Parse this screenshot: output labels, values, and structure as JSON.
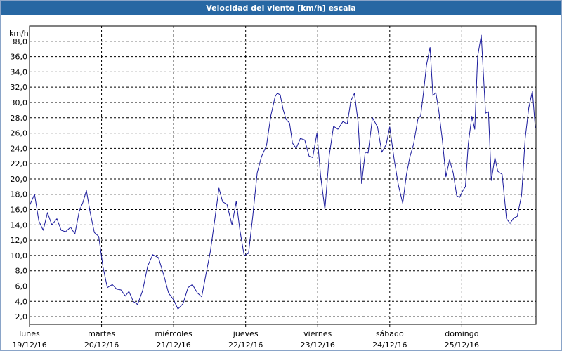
{
  "window": {
    "title": "Velocidad del viento [km/h] escala"
  },
  "colors": {
    "title_bar": "#2767a3",
    "series": "#1a1a9c",
    "grid": "#000000"
  },
  "chart_data": {
    "type": "line",
    "title": "Velocidad del viento [km/h] escala",
    "ylabel": "km/h",
    "xlabel": "",
    "ylim": [
      1.0,
      40.0
    ],
    "xlim": [
      0,
      7.03
    ],
    "grid": true,
    "y_ticks": [
      "2,0",
      "4,0",
      "6,0",
      "8,0",
      "10,0",
      "12,0",
      "14,0",
      "16,0",
      "18,0",
      "20,0",
      "22,0",
      "24,0",
      "26,0",
      "28,0",
      "30,0",
      "32,0",
      "34,0",
      "36,0",
      "38,0"
    ],
    "x_ticks": [
      {
        "day": "lunes",
        "date": "19/12/16"
      },
      {
        "day": "martes",
        "date": "20/12/16"
      },
      {
        "day": "miércoles",
        "date": "21/12/16"
      },
      {
        "day": "jueves",
        "date": "22/12/16"
      },
      {
        "day": "viernes",
        "date": "23/12/16"
      },
      {
        "day": "sábado",
        "date": "24/12/16"
      },
      {
        "day": "domingo",
        "date": "25/12/16"
      }
    ],
    "series": [
      {
        "name": "",
        "x": [
          0,
          0.07,
          0.13,
          0.19,
          0.25,
          0.31,
          0.38,
          0.44,
          0.5,
          0.57,
          0.63,
          0.69,
          0.74,
          0.79,
          0.84,
          0.9,
          0.96,
          1.02,
          1.08,
          1.15,
          1.21,
          1.27,
          1.33,
          1.38,
          1.44,
          1.5,
          1.57,
          1.64,
          1.71,
          1.79,
          1.87,
          1.93,
          2,
          2.06,
          2.13,
          2.2,
          2.26,
          2.33,
          2.39,
          2.45,
          2.51,
          2.57,
          2.63,
          2.68,
          2.74,
          2.81,
          2.87,
          2.92,
          2.98,
          3.04,
          3.1,
          3.16,
          3.22,
          3.29,
          3.35,
          3.41,
          3.44,
          3.48,
          3.52,
          3.56,
          3.61,
          3.65,
          3.7,
          3.76,
          3.82,
          3.88,
          3.93,
          3.99,
          4.04,
          4.1,
          4.16,
          4.22,
          4.28,
          4.35,
          4.41,
          4.46,
          4.51,
          4.56,
          4.61,
          4.66,
          4.7,
          4.76,
          4.83,
          4.89,
          4.95,
          5,
          5.06,
          5.12,
          5.18,
          5.23,
          5.28,
          5.33,
          5.39,
          5.43,
          5.47,
          5.51,
          5.56,
          5.6,
          5.64,
          5.68,
          5.73,
          5.78,
          5.83,
          5.88,
          5.93,
          5.97,
          6.01,
          6.05,
          6.09,
          6.14,
          6.18,
          6.22,
          6.27,
          6.33,
          6.37,
          6.41,
          6.46,
          6.5,
          6.56,
          6.62,
          6.67,
          6.72,
          6.77,
          6.83,
          6.88,
          6.93,
          6.98,
          7.02
        ],
        "y": [
          16.5,
          18,
          14.5,
          13.3,
          15.6,
          14,
          14.8,
          13.3,
          13.1,
          13.7,
          12.8,
          15.8,
          16.9,
          18.5,
          15.7,
          13,
          12.5,
          8.5,
          5.8,
          6.2,
          5.6,
          5.5,
          4.7,
          5.3,
          4,
          3.6,
          5.4,
          8.6,
          10.1,
          9.7,
          7.2,
          5.1,
          4.2,
          3,
          3.7,
          5.8,
          6.2,
          5.1,
          4.6,
          7.6,
          10.5,
          14.6,
          18.8,
          17,
          16.7,
          14,
          17.1,
          13.3,
          10,
          10.3,
          15.2,
          20.8,
          22.9,
          24.4,
          28.3,
          30.8,
          31.2,
          31,
          29.1,
          27.8,
          27.3,
          24.7,
          24,
          25.3,
          25.1,
          23,
          22.8,
          26,
          20.5,
          16,
          23.1,
          26.9,
          26.5,
          27.5,
          27.2,
          30.2,
          31.2,
          27.5,
          19.4,
          23.5,
          23.4,
          28,
          26.8,
          23.5,
          24.5,
          26.8,
          22.6,
          19.2,
          16.8,
          20.5,
          22.9,
          24.5,
          27.8,
          28.3,
          31.4,
          34.9,
          37.2,
          30.9,
          31.3,
          29,
          25.1,
          20.3,
          22.5,
          20.8,
          17.8,
          17.6,
          18.4,
          19,
          24.6,
          28.2,
          26.5,
          36,
          38.8,
          28.6,
          28.8,
          19.8,
          22.8,
          21,
          20.6,
          14.8,
          14.2,
          14.9,
          15.1,
          17.9,
          25.3,
          29.3,
          31.5,
          26.7
        ]
      }
    ]
  }
}
